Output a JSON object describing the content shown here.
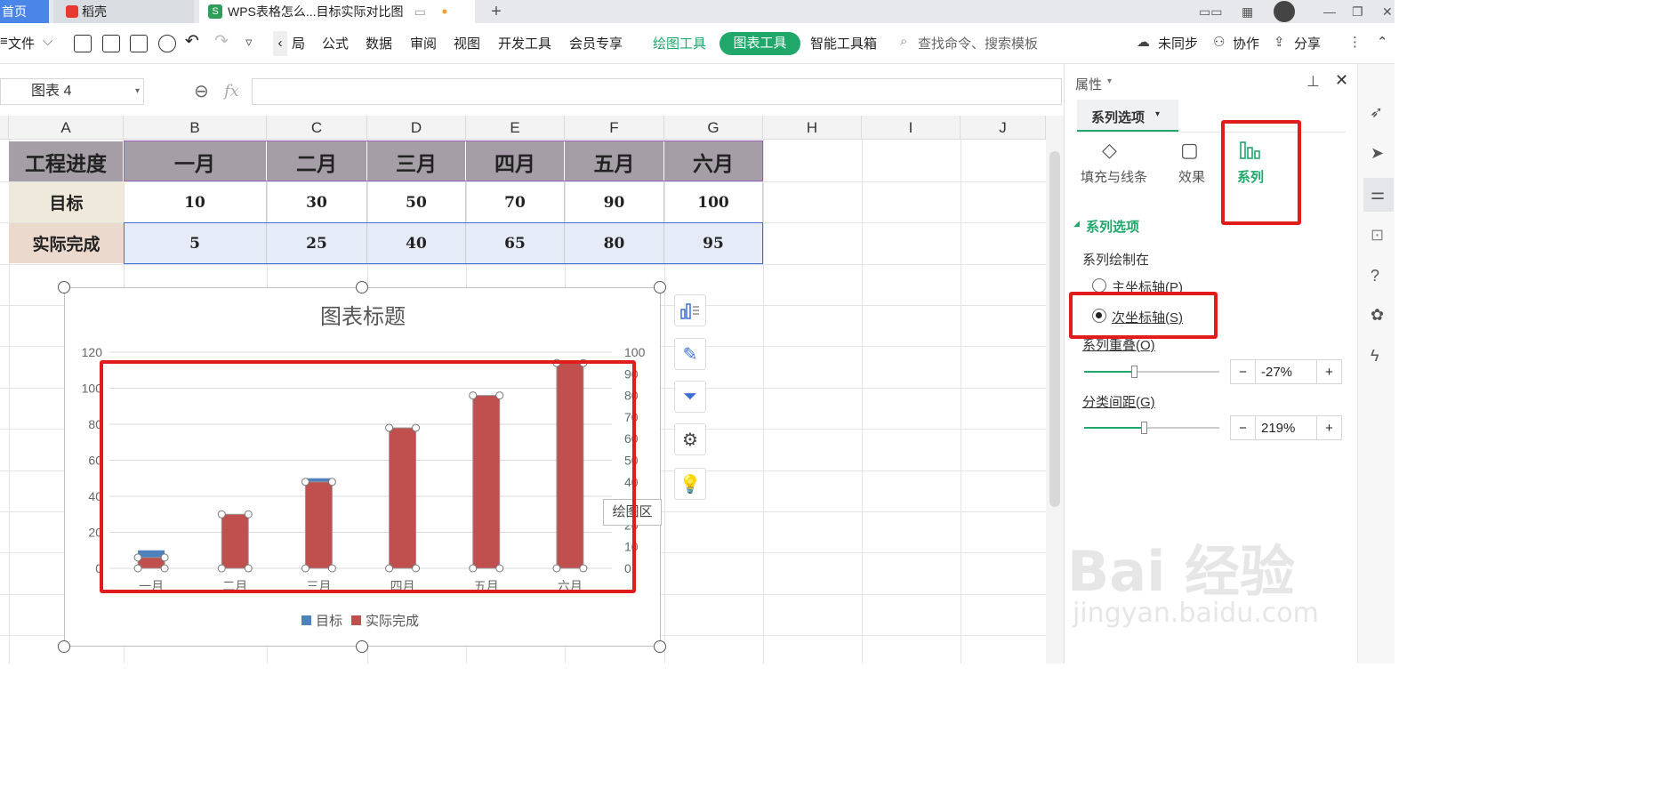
{
  "tabs": {
    "home": "首页",
    "daoke": "稻壳",
    "active": "WPS表格怎么...目标实际对比图",
    "add": "+"
  },
  "toolbar": {
    "file": "文件",
    "items": [
      "局",
      "公式",
      "数据",
      "审阅",
      "视图",
      "开发工具",
      "会员专享"
    ],
    "draw_tools": "绘图工具",
    "chart_tools": "图表工具",
    "smart_tools": "智能工具箱",
    "search_placeholder": "查找命令、搜索模板",
    "sync": "未同步",
    "collab": "协作",
    "share": "分享"
  },
  "formula": {
    "name_box": "图表 4",
    "fx": "fx"
  },
  "sheet": {
    "columns": [
      "A",
      "B",
      "C",
      "D",
      "E",
      "F",
      "G",
      "H",
      "I",
      "J"
    ],
    "header_row": [
      "工程进度",
      "一月",
      "二月",
      "三月",
      "四月",
      "五月",
      "六月"
    ],
    "target_row": [
      "目标",
      "10",
      "30",
      "50",
      "70",
      "90",
      "100"
    ],
    "actual_row": [
      "实际完成",
      "5",
      "25",
      "40",
      "65",
      "80",
      "95"
    ]
  },
  "chart_data": {
    "type": "bar",
    "title": "图表标题",
    "categories": [
      "一月",
      "二月",
      "三月",
      "四月",
      "五月",
      "六月"
    ],
    "series": [
      {
        "name": "目标",
        "values": [
          10,
          30,
          50,
          70,
          90,
          100
        ],
        "color": "#4f81bd",
        "axis": "primary"
      },
      {
        "name": "实际完成",
        "values": [
          5,
          25,
          40,
          65,
          80,
          95
        ],
        "color": "#c0504d",
        "axis": "secondary"
      }
    ],
    "ylim": [
      0,
      120
    ],
    "y2lim": [
      0,
      100
    ],
    "y_ticks": [
      "0",
      "20",
      "40",
      "60",
      "80",
      "100",
      "120"
    ],
    "y2_ticks": [
      "0",
      "10",
      "20",
      "30",
      "40",
      "50",
      "60",
      "70",
      "80",
      "90",
      "100"
    ],
    "legend": "bottom",
    "grid": true
  },
  "chart_ui": {
    "tooltip": "绘图区"
  },
  "panel": {
    "title": "属性",
    "tab": "系列选项",
    "sub_tabs": [
      "填充与线条",
      "效果",
      "系列"
    ],
    "section": "系列选项",
    "plot_on": "系列绘制在",
    "primary_axis": "主坐标轴(P)",
    "secondary_axis": "次坐标轴(S)",
    "overlap_label": "系列重叠(O)",
    "overlap_value": "-27%",
    "overlap_fraction": 0.37,
    "gap_label": "分类间距(G)",
    "gap_value": "219%",
    "gap_fraction": 0.44,
    "minus": "−",
    "plus": "+"
  },
  "watermark": {
    "brand": "Bai 经验",
    "url": "jingyan.baidu.com"
  },
  "colors": {
    "accent": "#1fa86a",
    "highlight": "#e21b1b",
    "header_fill": "#a59ea6"
  }
}
